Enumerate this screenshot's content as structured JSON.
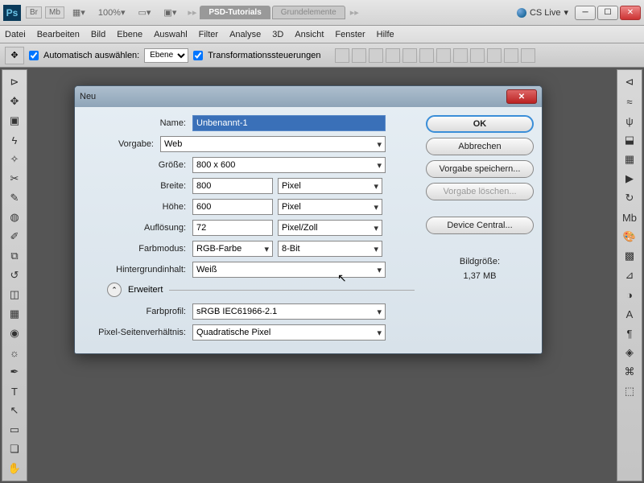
{
  "titlebar": {
    "zoom": "100%",
    "workspace_active": "PSD-Tutorials",
    "workspace_inactive": "Grundelemente",
    "cslive": "CS Live"
  },
  "menu": [
    "Datei",
    "Bearbeiten",
    "Bild",
    "Ebene",
    "Auswahl",
    "Filter",
    "Analyse",
    "3D",
    "Ansicht",
    "Fenster",
    "Hilfe"
  ],
  "options": {
    "auto_select": "Automatisch auswählen:",
    "auto_select_val": "Ebene",
    "transform": "Transformationssteuerungen"
  },
  "dialog": {
    "title": "Neu",
    "labels": {
      "name": "Name:",
      "preset": "Vorgabe:",
      "size": "Größe:",
      "width": "Breite:",
      "height": "Höhe:",
      "resolution": "Auflösung:",
      "colormode": "Farbmodus:",
      "background": "Hintergrundinhalt:",
      "advanced": "Erweitert",
      "colorprofile": "Farbprofil:",
      "pixelaspect": "Pixel-Seitenverhältnis:",
      "imagesize_label": "Bildgröße:"
    },
    "values": {
      "name": "Unbenannt-1",
      "preset": "Web",
      "size": "800 x 600",
      "width": "800",
      "width_unit": "Pixel",
      "height": "600",
      "height_unit": "Pixel",
      "resolution": "72",
      "resolution_unit": "Pixel/Zoll",
      "colormode": "RGB-Farbe",
      "bitdepth": "8-Bit",
      "background": "Weiß",
      "colorprofile": "sRGB IEC61966-2.1",
      "pixelaspect": "Quadratische Pixel",
      "imagesize": "1,37 MB"
    },
    "buttons": {
      "ok": "OK",
      "cancel": "Abbrechen",
      "save_preset": "Vorgabe speichern...",
      "delete_preset": "Vorgabe löschen...",
      "device_central": "Device Central..."
    }
  }
}
